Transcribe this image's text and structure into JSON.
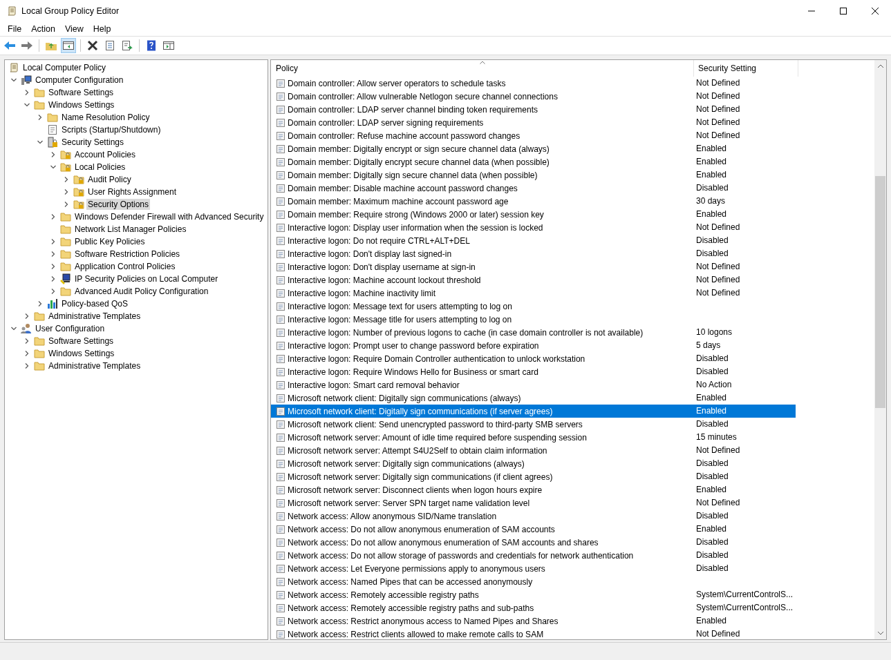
{
  "window": {
    "title": "Local Group Policy Editor"
  },
  "menu": [
    "File",
    "Action",
    "View",
    "Help"
  ],
  "tree": [
    {
      "label": "Local Computer Policy",
      "kind": "policy",
      "selected": false,
      "children": [
        {
          "label": "Computer Configuration",
          "kind": "computer",
          "expanded": true,
          "selected": false,
          "children": [
            {
              "label": "Software Settings",
              "kind": "folder",
              "expanded": false,
              "selected": false
            },
            {
              "label": "Windows Settings",
              "kind": "folder",
              "expanded": true,
              "selected": false,
              "children": [
                {
                  "label": "Name Resolution Policy",
                  "kind": "folder",
                  "expanded": false,
                  "selected": false
                },
                {
                  "label": "Scripts (Startup/Shutdown)",
                  "kind": "script",
                  "selected": false
                },
                {
                  "label": "Security Settings",
                  "kind": "security",
                  "expanded": true,
                  "selected": false,
                  "children": [
                    {
                      "label": "Account Policies",
                      "kind": "lockfolder",
                      "expanded": false,
                      "selected": false
                    },
                    {
                      "label": "Local Policies",
                      "kind": "lockfolder",
                      "expanded": true,
                      "selected": false,
                      "children": [
                        {
                          "label": "Audit Policy",
                          "kind": "lockfolder",
                          "expanded": false,
                          "selected": false
                        },
                        {
                          "label": "User Rights Assignment",
                          "kind": "lockfolder",
                          "expanded": false,
                          "selected": false
                        },
                        {
                          "label": "Security Options",
                          "kind": "lockfolder",
                          "expanded": false,
                          "selected": true
                        }
                      ]
                    },
                    {
                      "label": "Windows Defender Firewall with Advanced Security",
                      "kind": "folder",
                      "expanded": false,
                      "selected": false
                    },
                    {
                      "label": "Network List Manager Policies",
                      "kind": "folder",
                      "selected": false
                    },
                    {
                      "label": "Public Key Policies",
                      "kind": "folder",
                      "expanded": false,
                      "selected": false
                    },
                    {
                      "label": "Software Restriction Policies",
                      "kind": "folder",
                      "expanded": false,
                      "selected": false
                    },
                    {
                      "label": "Application Control Policies",
                      "kind": "folder",
                      "expanded": false,
                      "selected": false
                    },
                    {
                      "label": "IP Security Policies on Local Computer",
                      "kind": "ip",
                      "expanded": false,
                      "selected": false
                    },
                    {
                      "label": "Advanced Audit Policy Configuration",
                      "kind": "folder",
                      "expanded": false,
                      "selected": false
                    }
                  ]
                },
                {
                  "label": "Policy-based QoS",
                  "kind": "qos",
                  "expanded": false,
                  "selected": false
                }
              ]
            },
            {
              "label": "Administrative Templates",
              "kind": "folder",
              "expanded": false,
              "selected": false
            }
          ]
        },
        {
          "label": "User Configuration",
          "kind": "user",
          "expanded": true,
          "selected": false,
          "children": [
            {
              "label": "Software Settings",
              "kind": "folder",
              "expanded": false,
              "selected": false
            },
            {
              "label": "Windows Settings",
              "kind": "folder",
              "expanded": false,
              "selected": false
            },
            {
              "label": "Administrative Templates",
              "kind": "folder",
              "expanded": false,
              "selected": false
            }
          ]
        }
      ]
    }
  ],
  "table": {
    "columns": [
      "Policy",
      "Security Setting"
    ],
    "rows": [
      {
        "policy": "Domain controller: Allow server operators to schedule tasks",
        "setting": "Not Defined",
        "selected": false
      },
      {
        "policy": "Domain controller: Allow vulnerable Netlogon secure channel connections",
        "setting": "Not Defined",
        "selected": false
      },
      {
        "policy": "Domain controller: LDAP server channel binding token requirements",
        "setting": "Not Defined",
        "selected": false
      },
      {
        "policy": "Domain controller: LDAP server signing requirements",
        "setting": "Not Defined",
        "selected": false
      },
      {
        "policy": "Domain controller: Refuse machine account password changes",
        "setting": "Not Defined",
        "selected": false
      },
      {
        "policy": "Domain member: Digitally encrypt or sign secure channel data (always)",
        "setting": "Enabled",
        "selected": false
      },
      {
        "policy": "Domain member: Digitally encrypt secure channel data (when possible)",
        "setting": "Enabled",
        "selected": false
      },
      {
        "policy": "Domain member: Digitally sign secure channel data (when possible)",
        "setting": "Enabled",
        "selected": false
      },
      {
        "policy": "Domain member: Disable machine account password changes",
        "setting": "Disabled",
        "selected": false
      },
      {
        "policy": "Domain member: Maximum machine account password age",
        "setting": "30 days",
        "selected": false
      },
      {
        "policy": "Domain member: Require strong (Windows 2000 or later) session key",
        "setting": "Enabled",
        "selected": false
      },
      {
        "policy": "Interactive logon: Display user information when the session is locked",
        "setting": "Not Defined",
        "selected": false
      },
      {
        "policy": "Interactive logon: Do not require CTRL+ALT+DEL",
        "setting": "Disabled",
        "selected": false
      },
      {
        "policy": "Interactive logon: Don't display last signed-in",
        "setting": "Disabled",
        "selected": false
      },
      {
        "policy": "Interactive logon: Don't display username at sign-in",
        "setting": "Not Defined",
        "selected": false
      },
      {
        "policy": "Interactive logon: Machine account lockout threshold",
        "setting": "Not Defined",
        "selected": false
      },
      {
        "policy": "Interactive logon: Machine inactivity limit",
        "setting": "Not Defined",
        "selected": false
      },
      {
        "policy": "Interactive logon: Message text for users attempting to log on",
        "selected": false
      },
      {
        "policy": "Interactive logon: Message title for users attempting to log on",
        "selected": false
      },
      {
        "policy": "Interactive logon: Number of previous logons to cache (in case domain controller is not available)",
        "setting": "10 logons",
        "selected": false
      },
      {
        "policy": "Interactive logon: Prompt user to change password before expiration",
        "setting": "5 days",
        "selected": false
      },
      {
        "policy": "Interactive logon: Require Domain Controller authentication to unlock workstation",
        "setting": "Disabled",
        "selected": false
      },
      {
        "policy": "Interactive logon: Require Windows Hello for Business or smart card",
        "setting": "Disabled",
        "selected": false
      },
      {
        "policy": "Interactive logon: Smart card removal behavior",
        "setting": "No Action",
        "selected": false
      },
      {
        "policy": "Microsoft network client: Digitally sign communications (always)",
        "setting": "Enabled",
        "selected": false
      },
      {
        "policy": "Microsoft network client: Digitally sign communications (if server agrees)",
        "setting": "Enabled",
        "selected": true
      },
      {
        "policy": "Microsoft network client: Send unencrypted password to third-party SMB servers",
        "setting": "Disabled",
        "selected": false
      },
      {
        "policy": "Microsoft network server: Amount of idle time required before suspending session",
        "setting": "15 minutes",
        "selected": false
      },
      {
        "policy": "Microsoft network server: Attempt S4U2Self to obtain claim information",
        "setting": "Not Defined",
        "selected": false
      },
      {
        "policy": "Microsoft network server: Digitally sign communications (always)",
        "setting": "Disabled",
        "selected": false
      },
      {
        "policy": "Microsoft network server: Digitally sign communications (if client agrees)",
        "setting": "Disabled",
        "selected": false
      },
      {
        "policy": "Microsoft network server: Disconnect clients when logon hours expire",
        "setting": "Enabled",
        "selected": false
      },
      {
        "policy": "Microsoft network server: Server SPN target name validation level",
        "setting": "Not Defined",
        "selected": false
      },
      {
        "policy": "Network access: Allow anonymous SID/Name translation",
        "setting": "Disabled",
        "selected": false
      },
      {
        "policy": "Network access: Do not allow anonymous enumeration of SAM accounts",
        "setting": "Enabled",
        "selected": false
      },
      {
        "policy": "Network access: Do not allow anonymous enumeration of SAM accounts and shares",
        "setting": "Disabled",
        "selected": false
      },
      {
        "policy": "Network access: Do not allow storage of passwords and credentials for network authentication",
        "setting": "Disabled",
        "selected": false
      },
      {
        "policy": "Network access: Let Everyone permissions apply to anonymous users",
        "setting": "Disabled",
        "selected": false
      },
      {
        "policy": "Network access: Named Pipes that can be accessed anonymously",
        "selected": false
      },
      {
        "policy": "Network access: Remotely accessible registry paths",
        "setting": "System\\CurrentControlS...",
        "selected": false
      },
      {
        "policy": "Network access: Remotely accessible registry paths and sub-paths",
        "setting": "System\\CurrentControlS...",
        "selected": false
      },
      {
        "policy": "Network access: Restrict anonymous access to Named Pipes and Shares",
        "setting": "Enabled",
        "selected": false
      },
      {
        "policy": "Network access: Restrict clients allowed to make remote calls to SAM",
        "setting": "Not Defined",
        "selected": false
      }
    ]
  }
}
